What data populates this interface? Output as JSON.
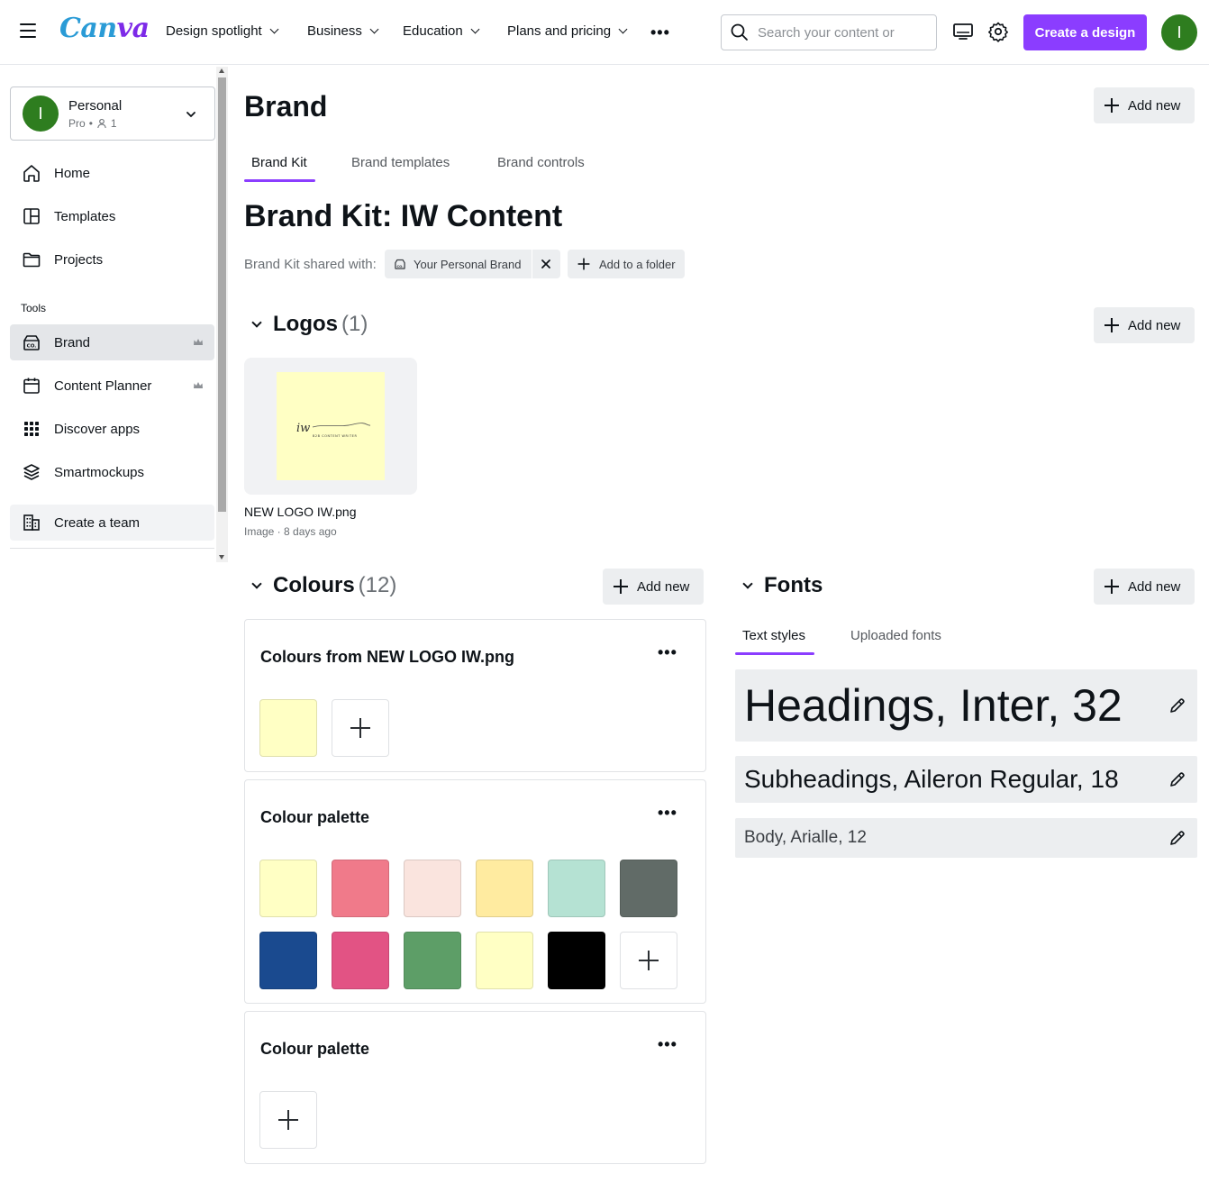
{
  "topbar": {
    "logo_part1": "Can",
    "logo_part2": "va",
    "nav": [
      "Design spotlight",
      "Business",
      "Education",
      "Plans and pricing"
    ],
    "more": "•••",
    "search_placeholder": "Search your content or",
    "create_label": "Create a design",
    "avatar_initial": "I"
  },
  "sidebar": {
    "team_name": "Personal",
    "team_plan": "Pro",
    "team_members": "1",
    "avatar_initial": "I",
    "items": [
      {
        "label": "Home",
        "icon": "home-icon"
      },
      {
        "label": "Templates",
        "icon": "templates-icon"
      },
      {
        "label": "Projects",
        "icon": "folder-icon"
      }
    ],
    "tools_label": "Tools",
    "tools": [
      {
        "label": "Brand",
        "icon": "brand-icon",
        "crown": true,
        "active": true
      },
      {
        "label": "Content Planner",
        "icon": "calendar-icon",
        "crown": true
      },
      {
        "label": "Discover apps",
        "icon": "apps-grid-icon"
      },
      {
        "label": "Smartmockups",
        "icon": "layers-icon"
      }
    ],
    "create_team": "Create a team"
  },
  "main": {
    "title": "Brand",
    "add_new": "Add new",
    "tabs": [
      "Brand Kit",
      "Brand templates",
      "Brand controls"
    ],
    "kit_title": "Brand Kit: IW Content",
    "shared_label": "Brand Kit shared with:",
    "shared_chip": "Your Personal Brand",
    "add_folder": "Add to a folder"
  },
  "logos": {
    "title": "Logos",
    "count": "(1)",
    "file_name": "NEW LOGO IW.png",
    "file_meta": "Image · 8 days ago",
    "logo_mark": "iw",
    "logo_subtitle": "B2B CONTENT WRITER"
  },
  "colours": {
    "title": "Colours",
    "count": "(12)",
    "palettes": [
      {
        "title": "Colours from NEW LOGO IW.png",
        "colors": [
          "#ffffc4"
        ]
      },
      {
        "title": "Colour palette",
        "colors": [
          "#ffffc4",
          "#f07a8a",
          "#fae4de",
          "#ffeba0",
          "#b5e2d3",
          "#616b67",
          "#1a4a8f",
          "#e25384",
          "#5d9e67",
          "#ffffc4",
          "#000000"
        ]
      },
      {
        "title": "Colour palette",
        "colors": []
      }
    ]
  },
  "fonts": {
    "title": "Fonts",
    "tabs": [
      "Text styles",
      "Uploaded fonts"
    ],
    "styles": [
      {
        "label": "Headings, Inter, 32"
      },
      {
        "label": "Subheadings, Aileron Regular, 18"
      },
      {
        "label": "Body, Arialle, 12"
      }
    ]
  },
  "colors": {
    "accent": "#8b3dff",
    "avatar": "#2e7d1f"
  }
}
